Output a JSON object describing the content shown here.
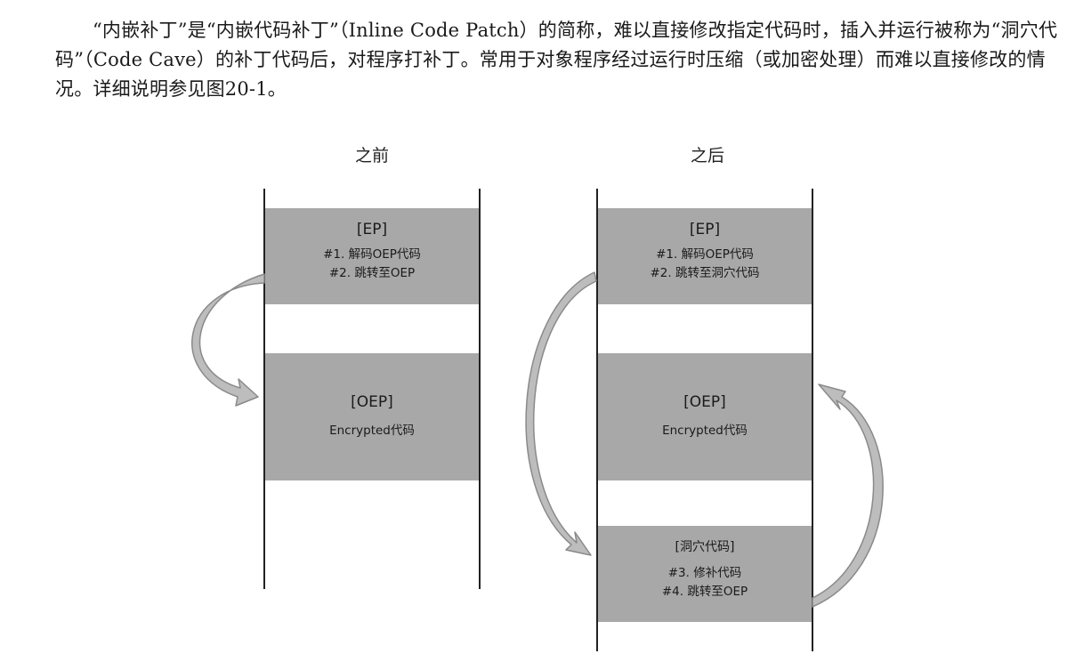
{
  "paragraph": "“内嵌补丁”是“内嵌代码补丁”（Inline Code Patch）的简称，难以直接修改指定代码时，插入并运行被称为“洞穴代码”（Code Cave）的补丁代码后，对程序打补丁。常用于对象程序经过运行时压缩（或加密处理）而难以直接修改的情况。详细说明参见图20-1。",
  "diagram": {
    "before": {
      "heading": "之前",
      "ep_block": {
        "title": "[EP]",
        "line1": "#1. 解码OEP代码",
        "line2": "#2. 跳转至OEP"
      },
      "oep_block": {
        "title": "[OEP]",
        "line1": "Encrypted代码"
      }
    },
    "after": {
      "heading": "之后",
      "ep_block": {
        "title": "[EP]",
        "line1": "#1. 解码OEP代码",
        "line2": "#2. 跳转至洞穴代码"
      },
      "oep_block": {
        "title": "[OEP]",
        "line1": "Encrypted代码"
      },
      "cave_block": {
        "title": "[洞穴代码]",
        "line1": "#3. 修补代码",
        "line2": "#4. 跳转至OEP"
      }
    },
    "colors": {
      "block_fill": "#a8a8a8",
      "arrow_fill": "#bdbdbd",
      "arrow_stroke": "#8a8a8a",
      "line": "#222222"
    }
  }
}
